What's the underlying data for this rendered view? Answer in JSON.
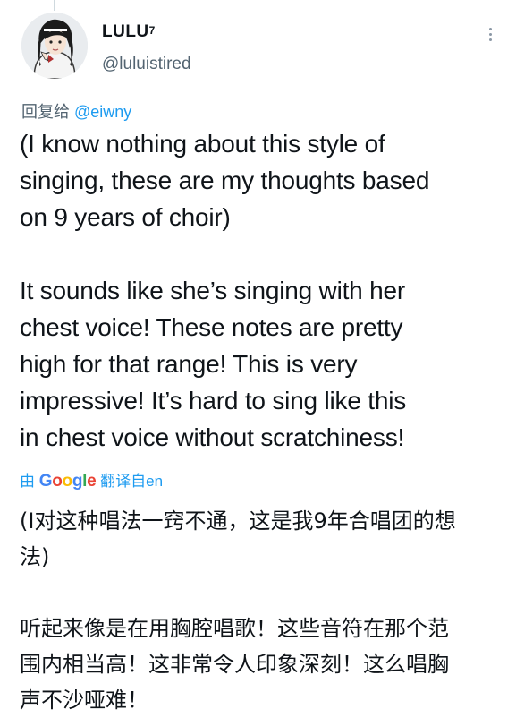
{
  "user": {
    "display_name": "LULU",
    "display_name_suffix": "7",
    "handle": "@luluistired",
    "avatar_icon": "avatar-illustration-icon"
  },
  "reply": {
    "prefix": "回复给",
    "mention": "@eiwny"
  },
  "tweet": {
    "para1_line1": "(I know nothing about this style of",
    "para1_line2": "singing, these are my thoughts based",
    "para1_line3": "on 9 years of choir)",
    "para2_line1": "It sounds like she’s singing with her",
    "para2_line2": "chest voice! These notes are pretty",
    "para2_line3": "high for that range! This is very",
    "para2_line4": "impressive! It’s hard to sing like this",
    "para2_line5": "in chest voice without scratchiness!"
  },
  "translation_label": {
    "prefix": "由",
    "google_G": "G",
    "google_o1": "o",
    "google_o2": "o",
    "google_g": "g",
    "google_l": "l",
    "google_e": "e",
    "suffix": "翻译自en"
  },
  "translation": {
    "para1_line1": "(I对这种唱法一窍不通，这是我9年合唱团的想",
    "para1_line2": "法)",
    "para2_line1": "听起来像是在用胸腔唱歌！这些音符在那个范",
    "para2_line2": "围内相当高！这非常令人印象深刻！这么唱胸",
    "para2_line3": "声不沙哑难！"
  },
  "colors": {
    "link": "#1d9bf0",
    "secondary_text": "#536471",
    "primary_text": "#0f1419"
  }
}
